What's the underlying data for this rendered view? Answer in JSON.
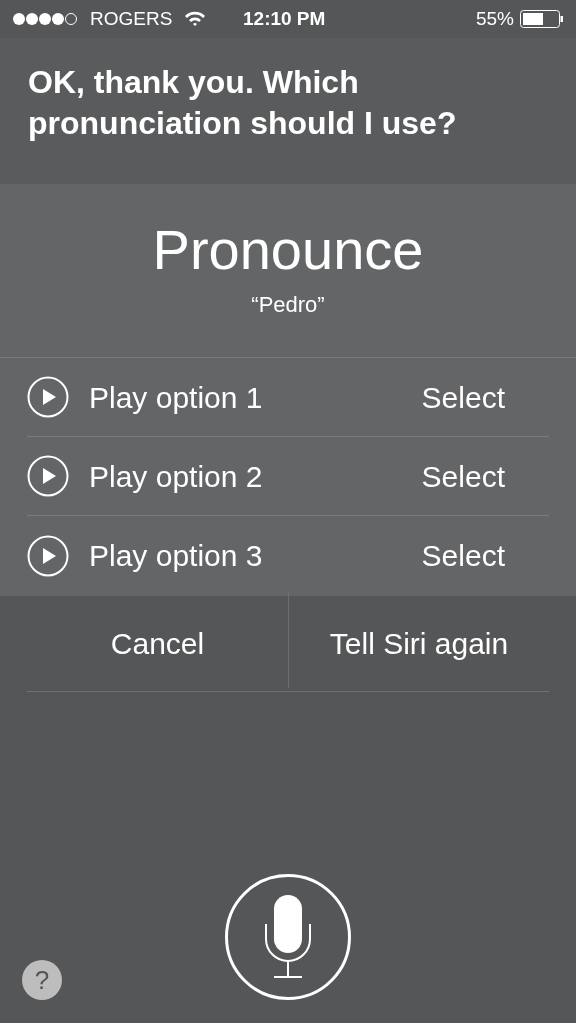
{
  "status_bar": {
    "carrier": "ROGERS",
    "time": "12:10 PM",
    "battery": "55%"
  },
  "prompt": "OK, thank you. Which pronunciation should I use?",
  "card": {
    "title": "Pronounce",
    "subtitle": "“Pedro”",
    "options": [
      {
        "label": "Play option 1",
        "action": "Select"
      },
      {
        "label": "Play option 2",
        "action": "Select"
      },
      {
        "label": "Play option 3",
        "action": "Select"
      }
    ]
  },
  "buttons": [
    "Cancel",
    "Tell Siri again"
  ],
  "help_button": "?"
}
